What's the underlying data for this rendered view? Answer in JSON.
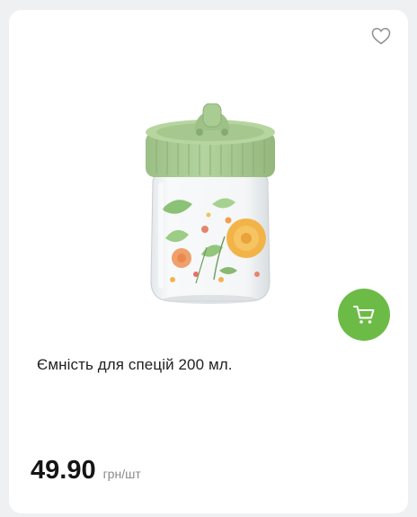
{
  "product": {
    "title": "Ємність для спецій 200 мл.",
    "price": "49.90",
    "unit": "грн/шт"
  },
  "icons": {
    "favorite": "heart-outline-icon",
    "cart": "shopping-cart-icon"
  },
  "colors": {
    "background": "#eef0f2",
    "card": "#ffffff",
    "accent": "#6cbb47",
    "lid": "#a8c991"
  }
}
